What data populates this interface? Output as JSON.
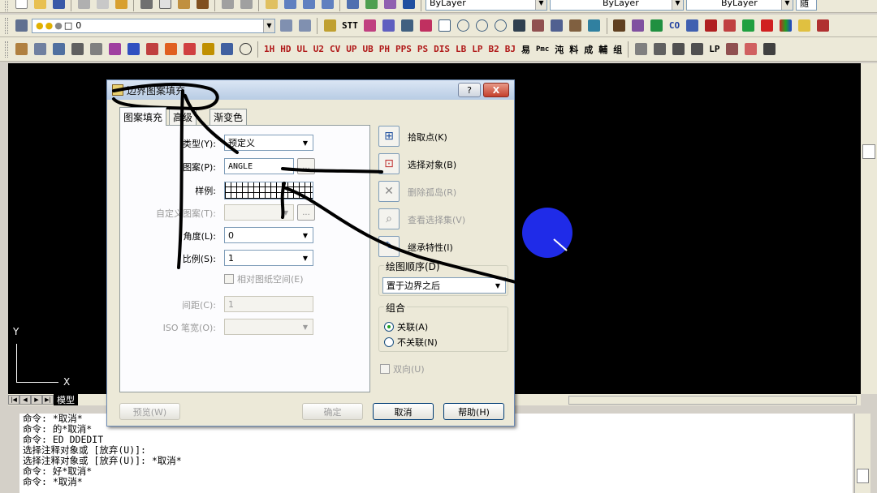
{
  "toolbar1": {
    "layer_combo": "ByLayer",
    "linetype_combo": "ByLayer",
    "lineweight_combo": "ByLayer",
    "right_text": "随"
  },
  "toolbar2": {
    "layer_value": "0",
    "tools": [
      "STT"
    ],
    "text_tools": [
      "CO"
    ]
  },
  "toolbar3": {
    "tools": [
      "1H",
      "HD",
      "UL",
      "U2",
      "CV",
      "UP",
      "UB",
      "PH",
      "PPS",
      "PS",
      "DIS",
      "LB",
      "LP",
      "B2",
      "BJ",
      "易",
      "Pmc",
      "沌",
      "料",
      "成",
      "輔",
      "组"
    ],
    "right_tools": [
      "LP"
    ]
  },
  "model_tab": "模型",
  "dialog": {
    "title": "边界图案填充",
    "help_label": "?",
    "close_label": "X",
    "tabs": [
      "图案填充",
      "高级",
      "渐变色"
    ],
    "fields": {
      "type_label": "类型(Y):",
      "type_value": "预定义",
      "pattern_label": "图案(P):",
      "pattern_value": "ANGLE",
      "sample_label": "样例:",
      "custom_label": "自定义图案(T):",
      "angle_label": "角度(L):",
      "angle_value": "0",
      "scale_label": "比例(S):",
      "scale_value": "1",
      "paper_label": "相对图纸空间(E)",
      "spacing_label": "间距(C):",
      "spacing_value": "1",
      "iso_label": "ISO 笔宽(O):",
      "dots": "..."
    },
    "right": {
      "pick_points": "拾取点(K)",
      "select_objects": "选择对象(B)",
      "remove_islands": "删除孤岛(R)",
      "view_selection": "查看选择集(V)",
      "inherit": "继承特性(I)",
      "draw_order_label": "绘图顺序(D)",
      "draw_order_value": "置于边界之后",
      "combine_label": "组合",
      "associative": "关联(A)",
      "non_associative": "不关联(N)",
      "double": "双向(U)"
    },
    "buttons": {
      "preview": "预览(W)",
      "ok": "确定",
      "cancel": "取消",
      "help": "帮助(H)"
    }
  },
  "ucs": {
    "x_label": "X",
    "y_label": "Y"
  },
  "command_lines": [
    "命令: *取消*",
    "命令: 的*取消*",
    "命令: ED DDEDIT",
    "选择注释对象或 [放弃(U)]:",
    "选择注释对象或 [放弃(U)]: *取消*",
    "命令: 好*取消*",
    "命令: *取消*"
  ],
  "colors": {
    "canvas": "#000000",
    "circle": "#1f2be8",
    "titlebar": "#b8cce4"
  }
}
